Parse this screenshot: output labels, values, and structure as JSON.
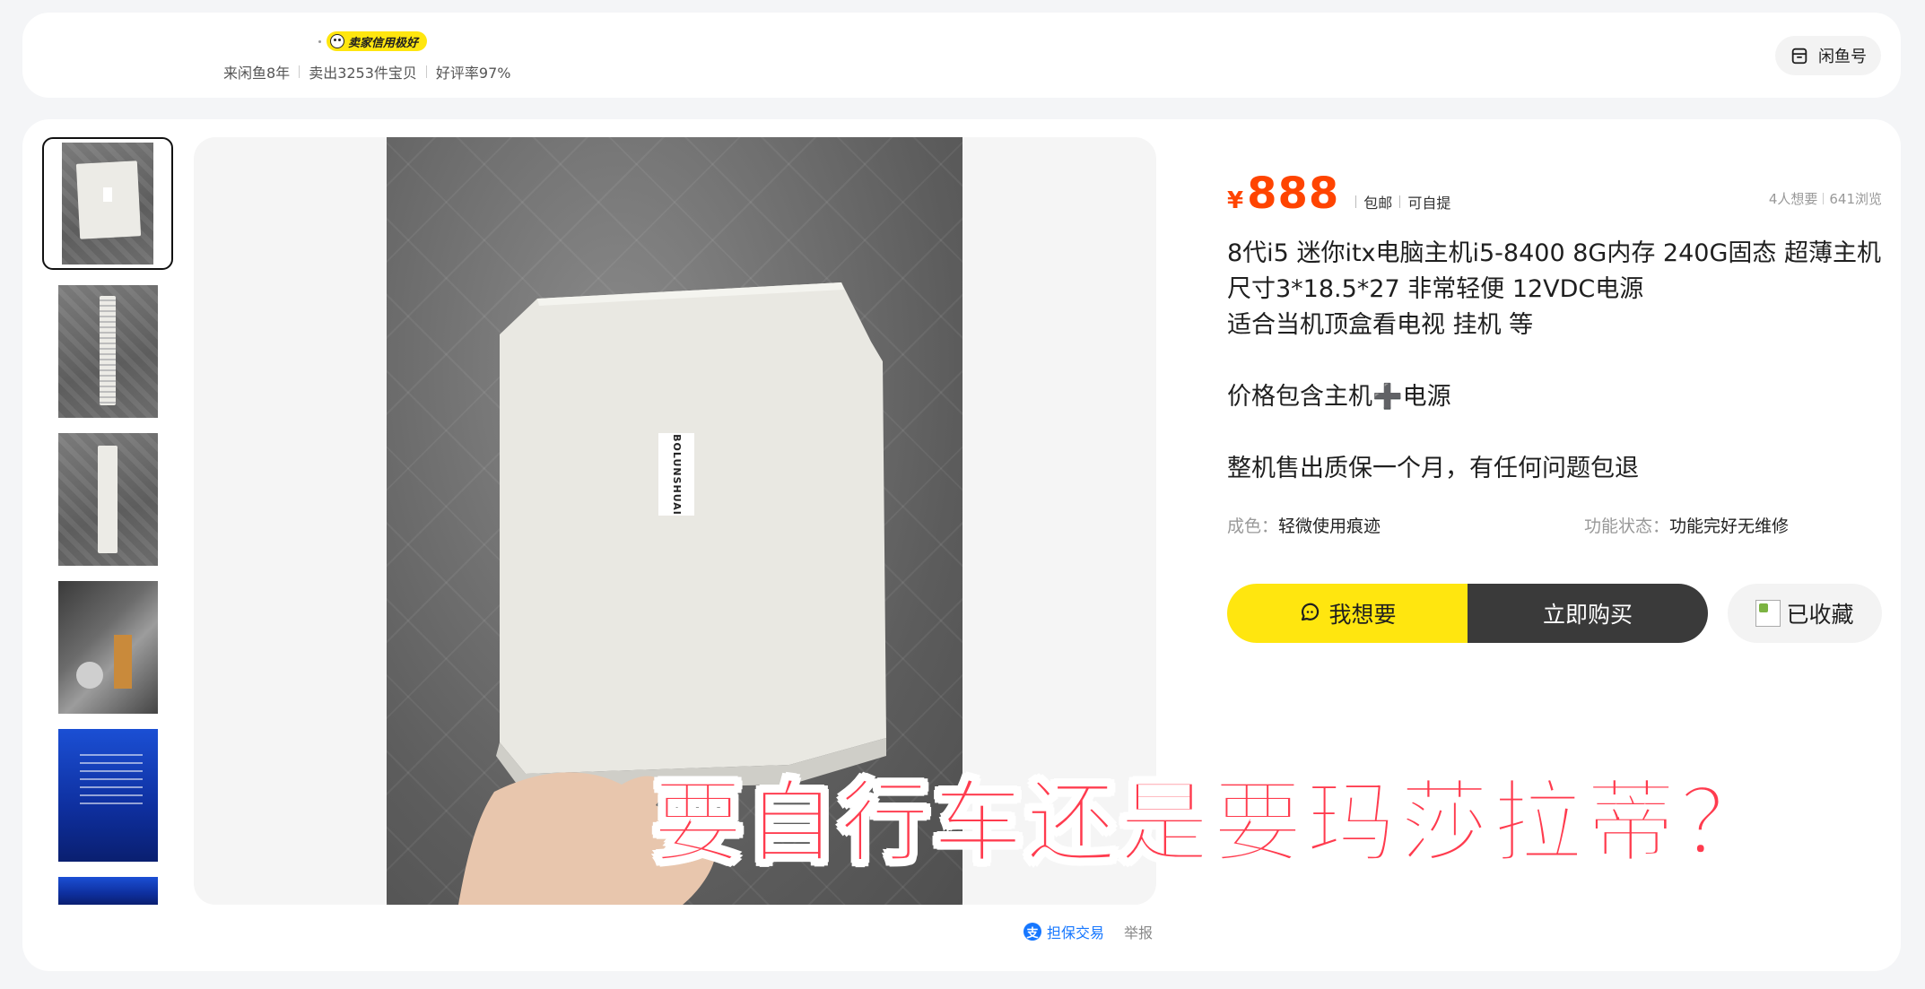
{
  "seller": {
    "credit_badge": "卖家信用极好",
    "stats": [
      "来闲鱼8年",
      "卖出3253件宝贝",
      "好评率97%"
    ],
    "id_button": "闲鱼号"
  },
  "product": {
    "price_symbol": "¥",
    "price": "888",
    "tags": [
      "包邮",
      "可自提"
    ],
    "want_count": "4人想要",
    "view_count": "641浏览",
    "description": {
      "line1": "8代i5 迷你itx电脑主机i5-8400 8G内存 240G固态 超薄主机 尺寸3*18.5*27 非常轻便 12VDC电源",
      "line2": "适合当机顶盒看电视 挂机 等",
      "line3_before": "价格包含主机",
      "line3_plus": "➕",
      "line3_after": "电源",
      "line4": "整机售出质保一个月，有任何问题包退"
    },
    "attributes": [
      {
        "key": "成色：",
        "value": "轻微使用痕迹"
      },
      {
        "key": "功能状态：",
        "value": "功能完好无维修"
      }
    ],
    "box_label": "BOLUNSHUAI"
  },
  "actions": {
    "want": "我想要",
    "buy": "立即购买",
    "favorite": "已收藏"
  },
  "footer": {
    "escrow_icon": "支",
    "escrow": "担保交易",
    "report": "举报"
  },
  "overlay_caption": "要自行车还是要玛莎拉蒂？"
}
